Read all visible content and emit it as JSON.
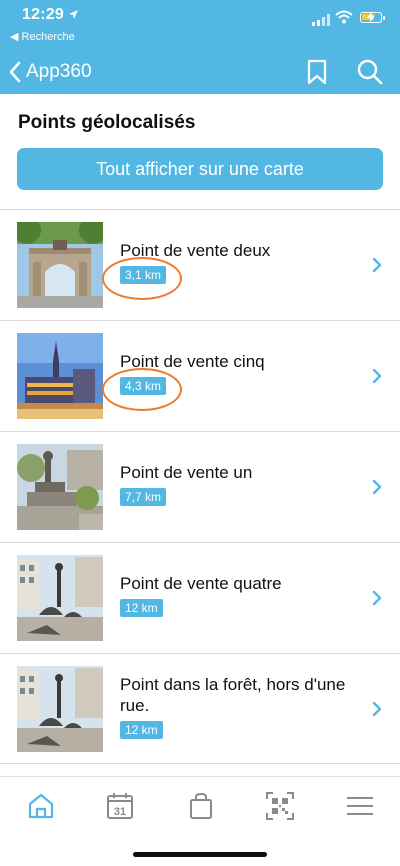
{
  "status_bar": {
    "time": "12:29",
    "back_app": "◀ Recherche"
  },
  "nav": {
    "back_label": "App360",
    "accent_color": "#53b7e4"
  },
  "section": {
    "title": "Points géolocalisés",
    "map_button_label": "Tout afficher sur une carte"
  },
  "points": [
    {
      "title": "Point de vente deux",
      "distance": "3,1 km",
      "image": "arch-monument",
      "highlighted": true
    },
    {
      "title": "Point de vente cinq",
      "distance": "4,3 km",
      "image": "grand-place-night",
      "highlighted": true
    },
    {
      "title": "Point de vente un",
      "distance": "7,7 km",
      "image": "statue-park",
      "highlighted": false
    },
    {
      "title": "Point de vente quatre",
      "distance": "12 km",
      "image": "sculpture-square",
      "highlighted": false
    },
    {
      "title": "Point dans la forêt, hors d'une rue.",
      "distance": "12 km",
      "image": "sculpture-square",
      "highlighted": false
    }
  ],
  "tabbar": {
    "calendar_day": "31",
    "items": [
      "home-icon",
      "calendar-icon",
      "shopping-bag-icon",
      "qr-code-icon",
      "menu-icon"
    ]
  },
  "annotation_color": "#ef7a2a"
}
